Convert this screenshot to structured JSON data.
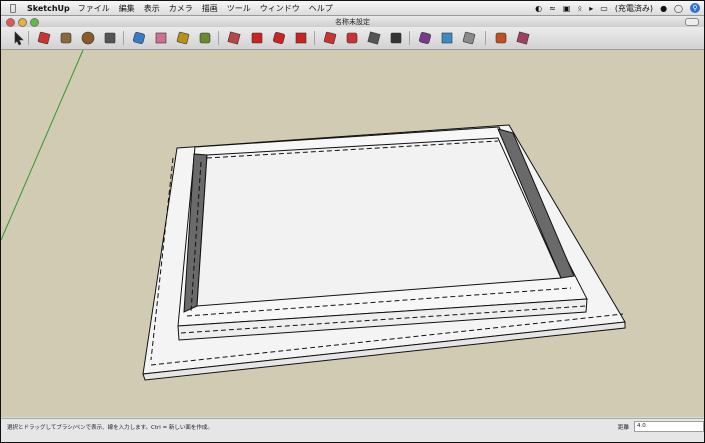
{
  "menubar": {
    "app_name": "SketchUp",
    "menus": [
      "ファイル",
      "編集",
      "表示",
      "カメラ",
      "描画",
      "ツール",
      "ウィンドウ",
      "ヘルプ"
    ],
    "battery_text": "(充電済み)"
  },
  "window": {
    "title": "名称未設定"
  },
  "toolbar": {
    "tools": [
      {
        "name": "select-tool",
        "color": "#222"
      },
      {
        "name": "pencil-tool",
        "color": "#c33"
      },
      {
        "name": "rectangle-tool",
        "color": "#8a6a3a"
      },
      {
        "name": "circle-tool",
        "color": "#8a5a2a"
      },
      {
        "name": "arc-tool",
        "color": "#555"
      },
      {
        "name": "paint-bucket-tool",
        "color": "#3a7ac8"
      },
      {
        "name": "eraser-tool",
        "color": "#d07090"
      },
      {
        "name": "tape-measure-tool",
        "color": "#b89018"
      },
      {
        "name": "text-tool",
        "color": "#6a8a30"
      },
      {
        "name": "push-pull-tool",
        "color": "#b44"
      },
      {
        "name": "move-tool",
        "color": "#c22"
      },
      {
        "name": "rotate-tool",
        "color": "#c22"
      },
      {
        "name": "follow-me-tool",
        "color": "#c22"
      },
      {
        "name": "offset-tool",
        "color": "#c33"
      },
      {
        "name": "orbit-tool",
        "color": "#c33"
      },
      {
        "name": "pan-tool",
        "color": "#555"
      },
      {
        "name": "zoom-tool",
        "color": "#333"
      },
      {
        "name": "zoom-extents-tool",
        "color": "#7a3a8a"
      },
      {
        "name": "previous-view-tool",
        "color": "#3a8ac8"
      },
      {
        "name": "next-view-tool",
        "color": "#8a8a8a"
      },
      {
        "name": "get-models-tool",
        "color": "#c05020"
      },
      {
        "name": "share-model-tool",
        "color": "#a04060"
      },
      {
        "name": "components-tool",
        "color": "#b06020"
      }
    ]
  },
  "status": {
    "hint": "選択とドラッグしてブラシ/ペンで表示、線を入力します。Ctrl = 新しい面を作成。",
    "value_label": "距離",
    "value": "4.0"
  },
  "colors": {
    "viewport_bg": "#d2cbb3",
    "face": "#f4f4f4",
    "inner_wall": "#6a6a6a",
    "axis_green": "#2e9a2e"
  }
}
